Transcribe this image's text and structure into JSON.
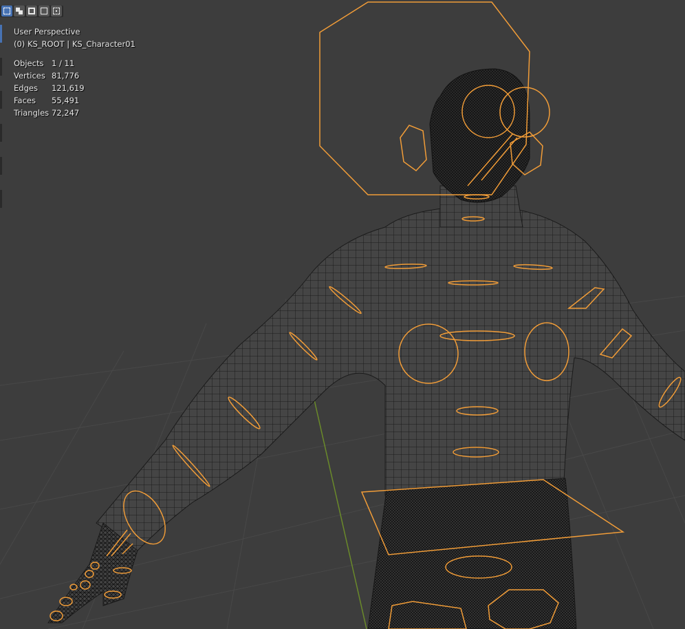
{
  "header": {
    "select_modes": [
      {
        "icon": "select-new-icon",
        "active": true
      },
      {
        "icon": "select-extend-icon",
        "active": false
      },
      {
        "icon": "select-subtract-icon",
        "active": false
      },
      {
        "icon": "select-difference-icon",
        "active": false
      },
      {
        "icon": "select-intersect-icon",
        "active": false
      }
    ]
  },
  "viewport": {
    "view_name": "User Perspective",
    "context": "(0) KS_ROOT | KS_Character01",
    "stats": [
      {
        "label": "Objects",
        "value": "1 / 11"
      },
      {
        "label": "Vertices",
        "value": "81,776"
      },
      {
        "label": "Edges",
        "value": "121,619"
      },
      {
        "label": "Faces",
        "value": "55,491"
      },
      {
        "label": "Triangles",
        "value": "72,247"
      }
    ]
  },
  "colors": {
    "background": "#3d3d3d",
    "grid": "#484848",
    "y_axis": "#6a8a2a",
    "wire": "#1a1a1a",
    "mesh_fill": "#454545",
    "bone": "#f29d38",
    "active_mode": "#4772b3"
  }
}
